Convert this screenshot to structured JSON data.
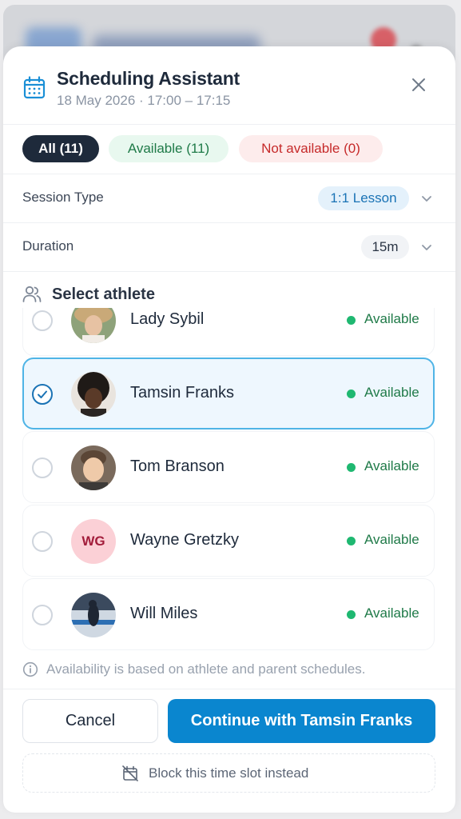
{
  "header": {
    "title": "Scheduling Assistant",
    "subtitle": "18 May 2026 · 17:00 – 17:15"
  },
  "filters": {
    "all": "All (11)",
    "available": "Available (11)",
    "not_available": "Not available (0)"
  },
  "settings": {
    "session_label": "Session Type",
    "session_value": "1:1 Lesson",
    "duration_label": "Duration",
    "duration_value": "15m"
  },
  "athletes_section": {
    "label": "Select athlete"
  },
  "athletes": [
    {
      "name": "Lady Sybil",
      "status": "Available",
      "selected": false,
      "avatar": "photo"
    },
    {
      "name": "Tamsin Franks",
      "status": "Available",
      "selected": true,
      "avatar": "photo"
    },
    {
      "name": "Tom Branson",
      "status": "Available",
      "selected": false,
      "avatar": "photo"
    },
    {
      "name": "Wayne Gretzky",
      "status": "Available",
      "selected": false,
      "avatar": "initials",
      "initials": "WG"
    },
    {
      "name": "Will Miles",
      "status": "Available",
      "selected": false,
      "avatar": "photo"
    }
  ],
  "info_text": "Availability is based on athlete and parent schedules.",
  "footer": {
    "cancel": "Cancel",
    "continue": "Continue with Tamsin Franks",
    "block": "Block this time slot instead"
  },
  "colors": {
    "accent": "#0a86cf",
    "available": "#1fb871",
    "selected_border": "#4fb4e6"
  }
}
